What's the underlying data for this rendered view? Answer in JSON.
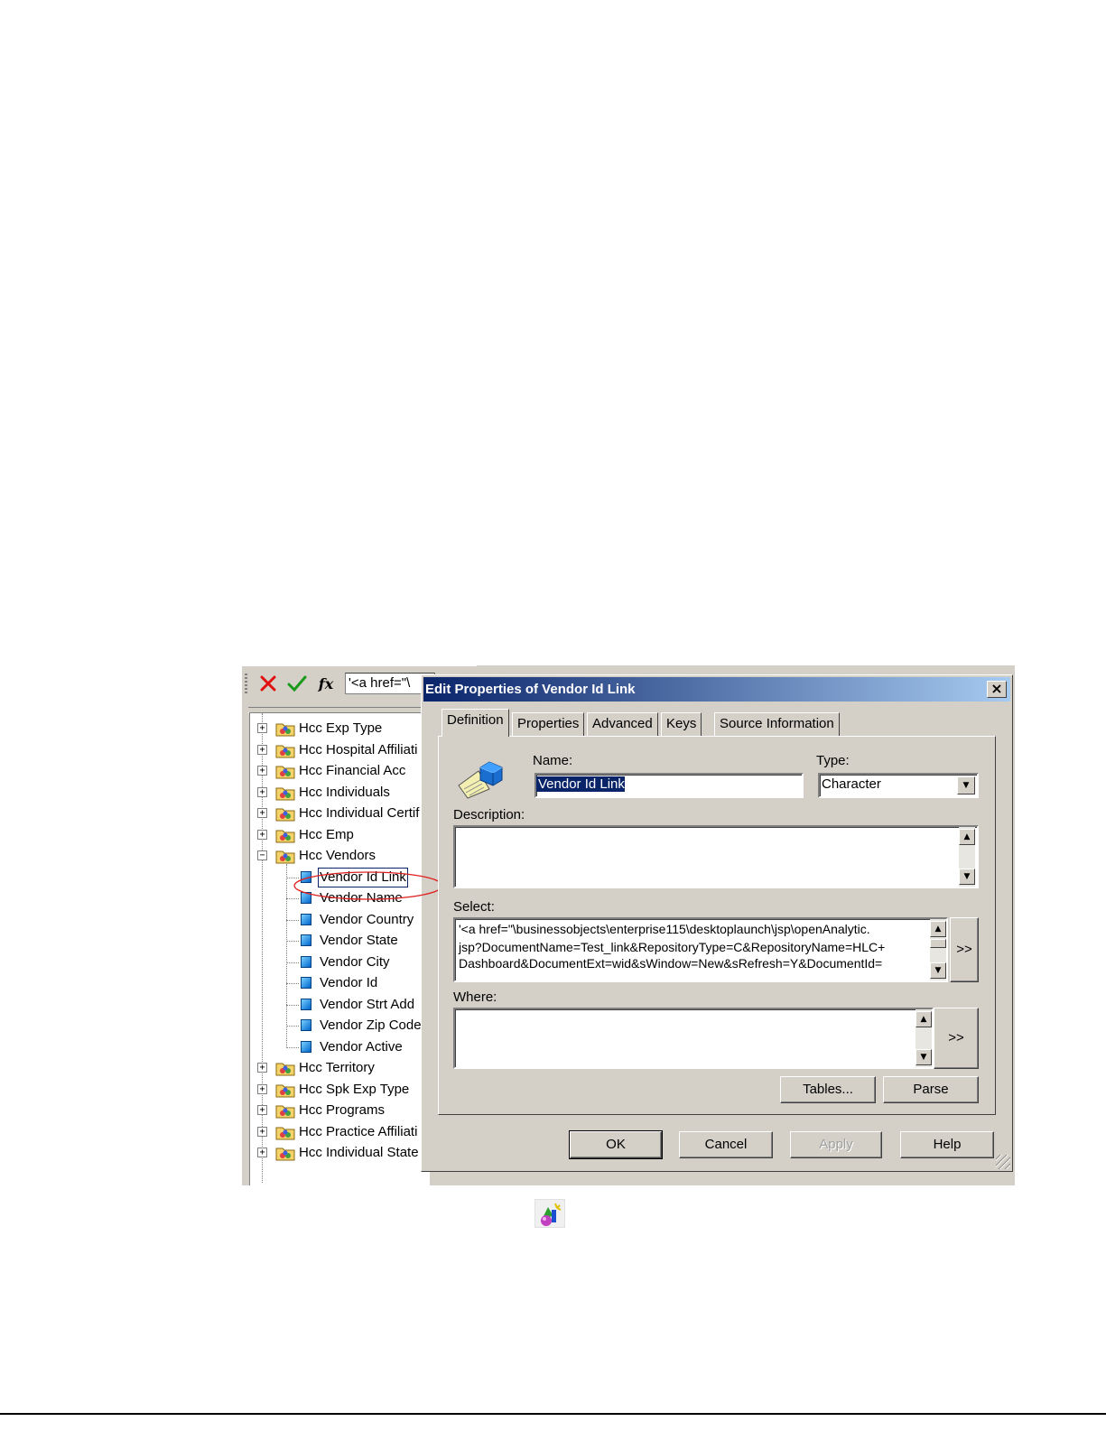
{
  "toolbar": {
    "cancel_icon": "red-x-icon",
    "accept_icon": "green-check-icon",
    "function_icon": "fx-icon",
    "function_label": "fx",
    "formula_value": "'<a href=\"\\"
  },
  "tree": {
    "items": [
      {
        "label": "Hcc Exp Type",
        "kind": "class",
        "expanded": false
      },
      {
        "label": "Hcc Hospital Affiliati",
        "kind": "class",
        "expanded": false
      },
      {
        "label": "Hcc Financial Acc",
        "kind": "class",
        "expanded": false
      },
      {
        "label": "Hcc Individuals",
        "kind": "class",
        "expanded": false
      },
      {
        "label": "Hcc Individual Certif",
        "kind": "class",
        "expanded": false
      },
      {
        "label": "Hcc Emp",
        "kind": "class",
        "expanded": false
      },
      {
        "label": "Hcc Vendors",
        "kind": "class",
        "expanded": true
      },
      {
        "label": "Vendor Id Link",
        "kind": "object",
        "selected": true
      },
      {
        "label": "Vendor Name",
        "kind": "object"
      },
      {
        "label": "Vendor Country",
        "kind": "object"
      },
      {
        "label": "Vendor State",
        "kind": "object"
      },
      {
        "label": "Vendor City",
        "kind": "object"
      },
      {
        "label": "Vendor Id",
        "kind": "object"
      },
      {
        "label": "Vendor Strt Add",
        "kind": "object"
      },
      {
        "label": "Vendor Zip Code",
        "kind": "object"
      },
      {
        "label": "Vendor Active",
        "kind": "object"
      },
      {
        "label": "Hcc Territory",
        "kind": "class",
        "expanded": false
      },
      {
        "label": "Hcc Spk Exp Type",
        "kind": "class",
        "expanded": false
      },
      {
        "label": "Hcc Programs",
        "kind": "class",
        "expanded": false
      },
      {
        "label": "Hcc Practice Affiliati",
        "kind": "class",
        "expanded": false
      },
      {
        "label": "Hcc Individual State",
        "kind": "class",
        "expanded": false
      }
    ]
  },
  "dialog": {
    "title": "Edit Properties of Vendor Id Link",
    "close_label": "×",
    "tabs": [
      "Definition",
      "Properties",
      "Advanced",
      "Keys",
      "Source Information"
    ],
    "active_tab": "Definition",
    "name_label": "Name:",
    "name_value": "Vendor Id Link",
    "type_label": "Type:",
    "type_value": "Character",
    "description_label": "Description:",
    "description_value": "",
    "select_label": "Select:",
    "select_lines": [
      "'<a href=\"\\businessobjects\\enterprise115\\desktoplaunch\\jsp\\openAnalytic.",
      "jsp?DocumentName=Test_link&RepositoryType=C&RepositoryName=HLC+",
      "Dashboard&DocumentExt=wid&sWindow=New&sRefresh=Y&DocumentId="
    ],
    "select_expand": ">>",
    "where_label": "Where:",
    "where_value": "",
    "where_expand": ">>",
    "tables_button": "Tables...",
    "parse_button": "Parse",
    "ok_button": "OK",
    "cancel_button": "Cancel",
    "apply_button": "Apply",
    "help_button": "Help"
  },
  "colors": {
    "annotation": "#e02020",
    "titlebar_start": "#0a246a",
    "titlebar_end": "#a6caf0",
    "window_face": "#d4d0c8"
  }
}
